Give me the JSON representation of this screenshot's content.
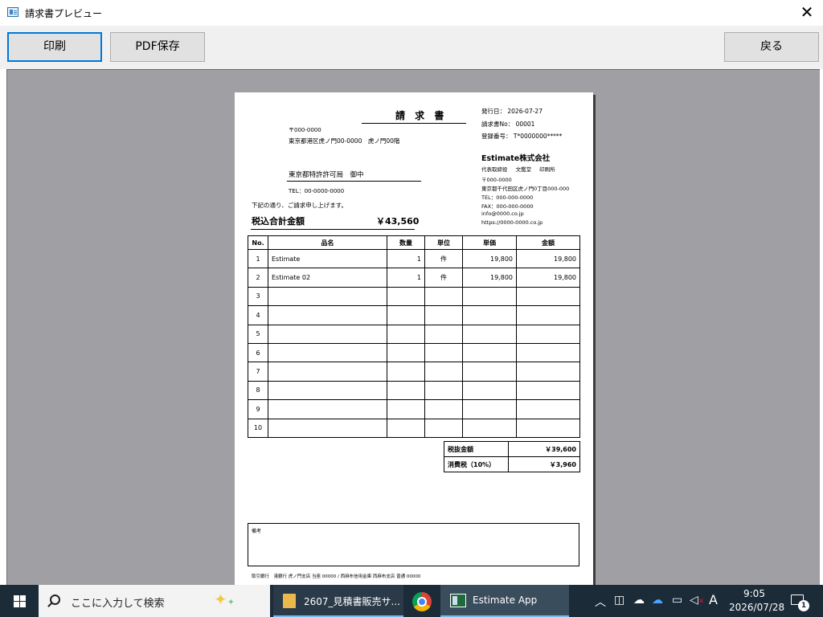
{
  "window": {
    "title": "請求書プレビュー",
    "close_glyph": "✕"
  },
  "toolbar": {
    "print_label": "印刷",
    "pdf_label": "PDF保存",
    "back_label": "戻る"
  },
  "invoice": {
    "title": "請 求 書",
    "issue_date": "発行日： 2026-07-27",
    "invoice_no": "請求書No： 00001",
    "registration_no": "登録番号： T*0000000*****",
    "customer": {
      "postal": "〒000-0000",
      "address": "東京都港区虎ノ門00-0000　虎ノ門00階",
      "name": "東京都特許許可局　御中",
      "tel": "TEL：00-0000-0000"
    },
    "greeting": "下記の通り、ご請求申し上げます。",
    "total_label": "税込合計金額",
    "total_value": "￥43,560",
    "company": {
      "name": "Estimate株式会社",
      "roles": "代表取締役 文鑑堂 印刷所",
      "postal": "〒000-0000",
      "address": "東京都千代田区虎ノ門0丁目000-000",
      "tel": "TEL：000-000-0000",
      "fax": "FAX：000-000-0000",
      "email": "info@0000.co.jp",
      "web": "https://0000-0000.co.jp"
    },
    "table": {
      "headers": [
        "No.",
        "品名",
        "数量",
        "単位",
        "単価",
        "金額"
      ],
      "rows": [
        [
          "1",
          "Estimate",
          "1",
          "件",
          "19,800",
          "19,800"
        ],
        [
          "2",
          "Estimate 02",
          "1",
          "件",
          "19,800",
          "19,800"
        ],
        [
          "3",
          "",
          "",
          "",
          "",
          ""
        ],
        [
          "4",
          "",
          "",
          "",
          "",
          ""
        ],
        [
          "5",
          "",
          "",
          "",
          "",
          ""
        ],
        [
          "6",
          "",
          "",
          "",
          "",
          ""
        ],
        [
          "7",
          "",
          "",
          "",
          "",
          ""
        ],
        [
          "8",
          "",
          "",
          "",
          "",
          ""
        ],
        [
          "9",
          "",
          "",
          "",
          "",
          ""
        ],
        [
          "10",
          "",
          "",
          "",
          "",
          ""
        ]
      ]
    },
    "summary": {
      "subtotal_label": "税抜金額",
      "subtotal_value": "￥39,600",
      "tax_label": "消費税（10%）",
      "tax_value": "￥3,960"
    },
    "remarks_label": "備考",
    "bank_info": "取引銀行　港銀行 虎ノ門支店 当座 00000 / 西麻布信用金庫 西麻布支店 普通 00000"
  },
  "taskbar": {
    "search_placeholder": "ここに入力して検索",
    "folder_task_label": "2607_見積書販売サ...",
    "app_task_label": "Estimate App",
    "tray_chevron": "︿",
    "ime_label": "A",
    "clock_time": "9:05",
    "clock_date": "2026/07/28",
    "notification_count": "1",
    "icons": [
      "windows-start-icon",
      "search-icon",
      "copilot-sparkle-icon",
      "folder-icon",
      "chrome-icon",
      "app-icon",
      "tray-chevron-icon",
      "meet-now-icon",
      "onedrive-icon",
      "network-icon",
      "volume-muted-icon",
      "ime-icon",
      "notification-icon"
    ]
  }
}
